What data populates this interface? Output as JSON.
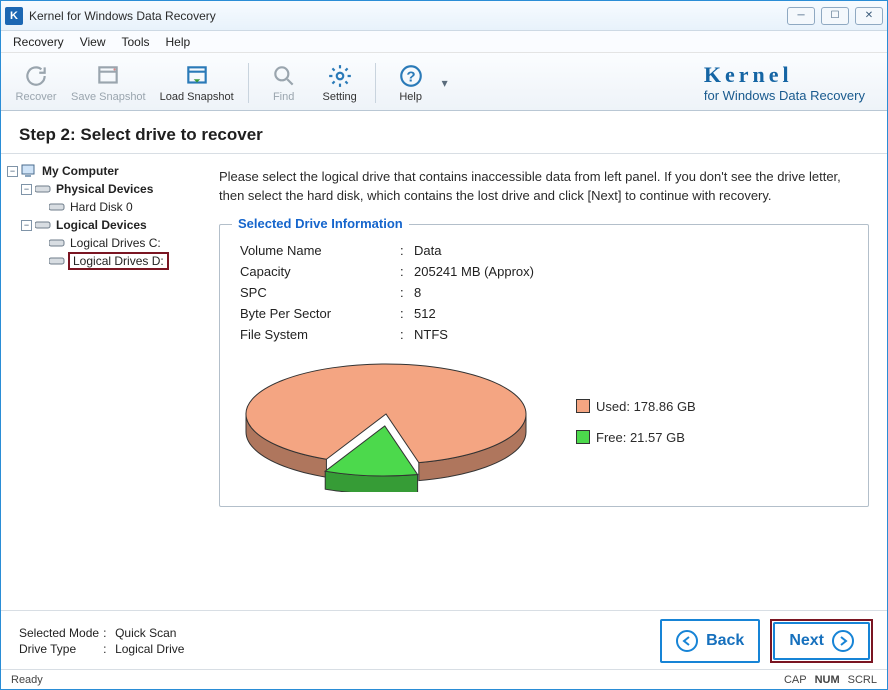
{
  "window": {
    "title": "Kernel for Windows Data Recovery"
  },
  "menu": {
    "recovery": "Recovery",
    "view": "View",
    "tools": "Tools",
    "help": "Help"
  },
  "toolbar": {
    "recover": "Recover",
    "save_snapshot": "Save Snapshot",
    "load_snapshot": "Load Snapshot",
    "find": "Find",
    "setting": "Setting",
    "help": "Help"
  },
  "brand": {
    "name": "Kernel",
    "sub": "for Windows Data Recovery"
  },
  "step": {
    "title": "Step 2: Select drive to recover"
  },
  "tree": {
    "my_computer": "My Computer",
    "physical": "Physical Devices",
    "hd0": "Hard Disk 0",
    "logical": "Logical Devices",
    "lc": "Logical Drives C:",
    "ld": "Logical Drives D:"
  },
  "instructions": "Please select the logical drive that contains inaccessible data from left panel. If you don't see the drive letter, then select the hard disk, which contains the lost drive and click [Next] to continue with recovery.",
  "group": {
    "legend": "Selected Drive Information",
    "rows": {
      "volume_name": {
        "k": "Volume Name",
        "v": "Data"
      },
      "capacity": {
        "k": "Capacity",
        "v": "205241 MB (Approx)"
      },
      "spc": {
        "k": "SPC",
        "v": "8"
      },
      "bps": {
        "k": "Byte Per Sector",
        "v": "512"
      },
      "fs": {
        "k": "File System",
        "v": "NTFS"
      }
    }
  },
  "chart_data": {
    "type": "pie",
    "title": "",
    "series": [
      {
        "name": "Used",
        "value_gb": 178.86,
        "label": "Used: 178.86 GB",
        "color": "#f4a582"
      },
      {
        "name": "Free",
        "value_gb": 21.57,
        "label": "Free: 21.57 GB",
        "color": "#4cd94c"
      }
    ]
  },
  "footer": {
    "mode_k": "Selected Mode",
    "mode_v": "Quick Scan",
    "drive_k": "Drive Type",
    "drive_v": "Logical Drive",
    "back": "Back",
    "next": "Next"
  },
  "status": {
    "ready": "Ready",
    "cap": "CAP",
    "num": "NUM",
    "scrl": "SCRL"
  }
}
